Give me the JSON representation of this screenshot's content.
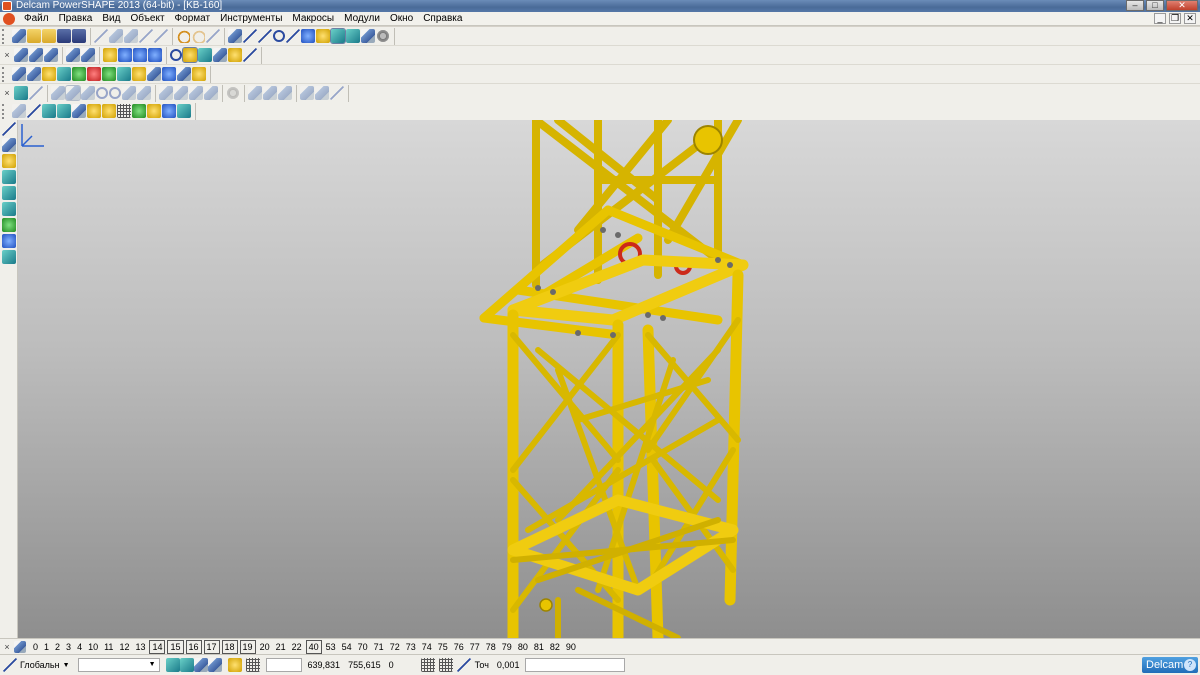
{
  "window": {
    "title": "Delcam PowerSHAPE 2013 (64-bit) - [KB-160]",
    "minimize": "–",
    "maximize": "□",
    "close": "✕"
  },
  "menubar": {
    "items": [
      "Файл",
      "Правка",
      "Вид",
      "Объект",
      "Формат",
      "Инструменты",
      "Макросы",
      "Модули",
      "Окно",
      "Справка"
    ],
    "mdi": {
      "minimize": "_",
      "restore": "❐",
      "close": "✕"
    }
  },
  "levels": {
    "numbers": [
      "0",
      "1",
      "2",
      "3",
      "4",
      "10",
      "11",
      "12",
      "13",
      "14",
      "15",
      "16",
      "17",
      "18",
      "19",
      "20",
      "21",
      "22",
      "40",
      "53",
      "54",
      "70",
      "71",
      "72",
      "73",
      "74",
      "75",
      "76",
      "77",
      "78",
      "79",
      "80",
      "81",
      "82",
      "90"
    ],
    "boxed": [
      "14",
      "15",
      "16",
      "17",
      "18",
      "19",
      "40"
    ]
  },
  "status": {
    "workplane_label": "Глобальн",
    "coord_x": "639,831",
    "coord_y": "755,615",
    "coord_z": "0",
    "tolerance_label": "Точ",
    "tolerance_value": "0,001",
    "logo": "Delcam"
  },
  "colors": {
    "model": "#e8c400",
    "model_dark": "#9c8400",
    "red_part": "#cc2a1a",
    "viewport_top": "#d8d8d8",
    "viewport_bottom": "#8e8e8e"
  }
}
